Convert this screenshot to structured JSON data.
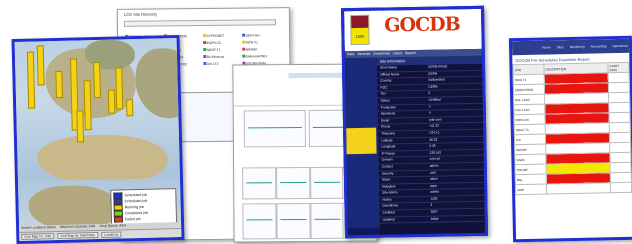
{
  "map_window": {
    "legend": [
      "Scheduled job",
      "Scheduled job",
      "Running job",
      "Completed job",
      "Failed job"
    ],
    "legend_colors": [
      "#1a2fd0",
      "#2a3f9f",
      "#f4d21a",
      "#7ed321",
      "#e03a2a"
    ],
    "tabs": [
      "Grid Map for Jobs",
      "Grid Map by Site/Class",
      "Locations"
    ],
    "status_items": [
      "Active Locations status",
      "Maximum Queues Jobs",
      "Drop Queue Jobs"
    ]
  },
  "directory_window": {
    "title": "LCG Site Directory",
    "entries": [
      "BEIJING-LCG2",
      "CERN-PROD",
      "CYFRONET",
      "DESY-HH",
      "FZK-LCG2",
      "GRIF",
      "IN2P3-CC",
      "INFN-T1",
      "JINR-LCG2",
      "KR-KISTI",
      "NDGF-T1",
      "NIKHEF",
      "PIC",
      "RAL-LCG2",
      "RU-Moscow",
      "SARA-MATRIX",
      "TRIUMF",
      "Taiwan-LCG2",
      "UKI-LT2",
      "USCMS-FNAL"
    ],
    "entry_colors": [
      "#2a9d3a",
      "#d43a2a",
      "#f0c020",
      "#2a6bd4",
      "#8a3ad4"
    ]
  },
  "gocdb_window": {
    "logo": "GOCDB",
    "badge": "1000",
    "nav_items": [
      "Sites",
      "Services",
      "Downtimes",
      "Users",
      "Search"
    ],
    "panel_title": "Site Information",
    "rows": [
      [
        "Short Name",
        "CERN-PROD"
      ],
      [
        "Official Name",
        "CERN"
      ],
      [
        "Country",
        "Switzerland"
      ],
      [
        "ROC",
        "CERN"
      ],
      [
        "Tier",
        "0"
      ],
      [
        "Status",
        "Certified"
      ],
      [
        "Production",
        "Y"
      ],
      [
        "Monitored",
        "Y"
      ],
      [
        "Email",
        "grid-cern"
      ],
      [
        "Phone",
        "+41 22"
      ],
      [
        "Timezone",
        "UTC+1"
      ],
      [
        "Latitude",
        "46.23"
      ],
      [
        "Longitude",
        "6.05"
      ],
      [
        "IP Range",
        "128.142"
      ],
      [
        "Domain",
        "cern.ch"
      ],
      [
        "Contact",
        "admin"
      ],
      [
        "Security",
        "csirt"
      ],
      [
        "Alarm",
        "alarm"
      ],
      [
        "Helpdesk",
        "ggus"
      ],
      [
        "Site Admin",
        "admin"
      ],
      [
        "Nodes",
        "1200"
      ],
      [
        "Downtimes",
        "3"
      ],
      [
        "Certified",
        "2007"
      ],
      [
        "Updated",
        "today"
      ]
    ]
  },
  "report_window": {
    "title": "GOCDB Pre-Scheduled Downtime Report",
    "nav": [
      "Home",
      "Sites",
      "Monitoring",
      "Accounting",
      "Operations"
    ],
    "columns": [
      "SITE",
      "DESCRIPTION",
      "START DATE"
    ],
    "rows": [
      {
        "site": "INFN-T1",
        "color": "#e8150f"
      },
      {
        "site": "CERN-PROD",
        "color": "#e8150f"
      },
      {
        "site": "RAL-LCG2",
        "color": "#ffffff"
      },
      {
        "site": "FZK-LCG2",
        "color": "#e8150f"
      },
      {
        "site": "IN2P3-CC",
        "color": "#e8150f"
      },
      {
        "site": "NDGF-T1",
        "color": "#ffffff"
      },
      {
        "site": "PIC",
        "color": "#e8150f"
      },
      {
        "site": "NIKHEF",
        "color": "#ffffff"
      },
      {
        "site": "SARA",
        "color": "#e8150f"
      },
      {
        "site": "TRIUMF",
        "color": "#f4e800"
      },
      {
        "site": "BNL",
        "color": "#e8150f"
      },
      {
        "site": "GRIF",
        "color": "#ffffff"
      }
    ]
  }
}
